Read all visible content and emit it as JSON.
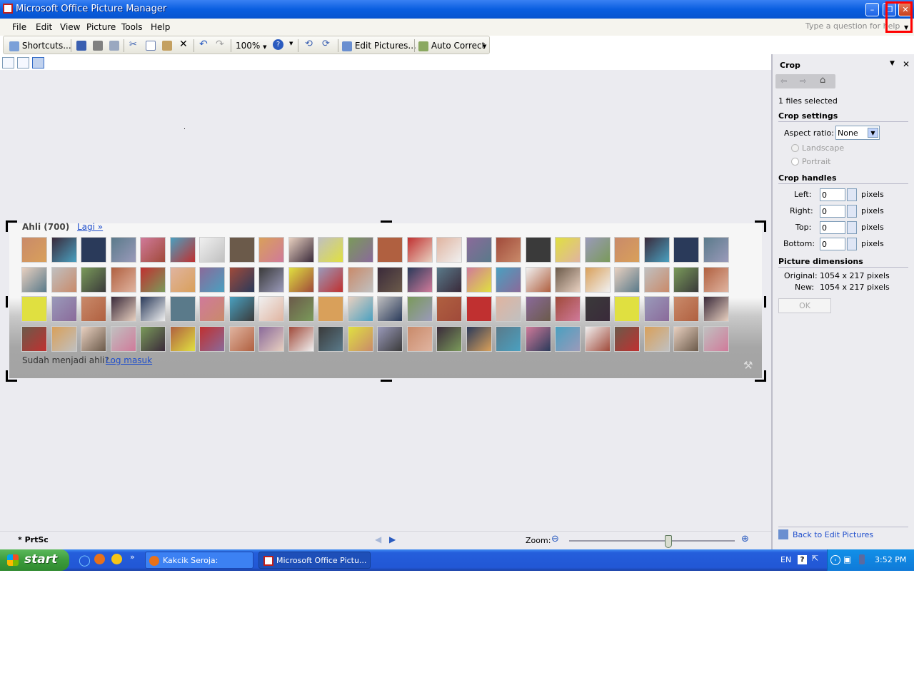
{
  "window": {
    "title": "Microsoft Office Picture Manager"
  },
  "menubar": {
    "items": [
      "File",
      "Edit",
      "View",
      "Picture",
      "Tools",
      "Help"
    ],
    "help_placeholder": "Type a question for help"
  },
  "toolbar": {
    "shortcuts_label": "Shortcuts...",
    "zoom_value": "100%",
    "edit_pictures_label": "Edit Pictures...",
    "auto_correct_label": "Auto Correct"
  },
  "image": {
    "heading": "Ahli (700)",
    "more_link": "Lagi »",
    "footer_text": "Sudah menjadi ahli?",
    "login_link": "Log masuk",
    "thumb_rows": 4,
    "thumb_cols": 24
  },
  "status": {
    "filename": "* PrtSc",
    "zoom_label": "Zoom:",
    "zoom_level": 0.6
  },
  "panel": {
    "title": "Crop",
    "files_selected": "1 files selected",
    "crop_settings_heading": "Crop settings",
    "aspect_ratio_label": "Aspect ratio:",
    "aspect_ratio_value": "None",
    "landscape_label": "Landscape",
    "portrait_label": "Portrait",
    "crop_handles_heading": "Crop handles",
    "handles": [
      {
        "label": "Left:",
        "value": "0",
        "unit": "pixels"
      },
      {
        "label": "Right:",
        "value": "0",
        "unit": "pixels"
      },
      {
        "label": "Top:",
        "value": "0",
        "unit": "pixels"
      },
      {
        "label": "Bottom:",
        "value": "0",
        "unit": "pixels"
      }
    ],
    "dimensions_heading": "Picture dimensions",
    "original_label": "Original:",
    "original_value": "1054 x 217 pixels",
    "new_label": "New:",
    "new_value": "1054 x 217 pixels",
    "ok_label": "OK",
    "back_link": "Back to Edit Pictures"
  },
  "taskbar": {
    "start_label": "start",
    "tasks": [
      "Kakcik Seroja: Klasik....",
      "Microsoft Office Pictu..."
    ],
    "lang": "EN",
    "clock": "3:52 PM"
  },
  "colors": {
    "highlight": "#ff0000",
    "link": "#1f4ecc",
    "titlebar": "#0a5ee0"
  }
}
